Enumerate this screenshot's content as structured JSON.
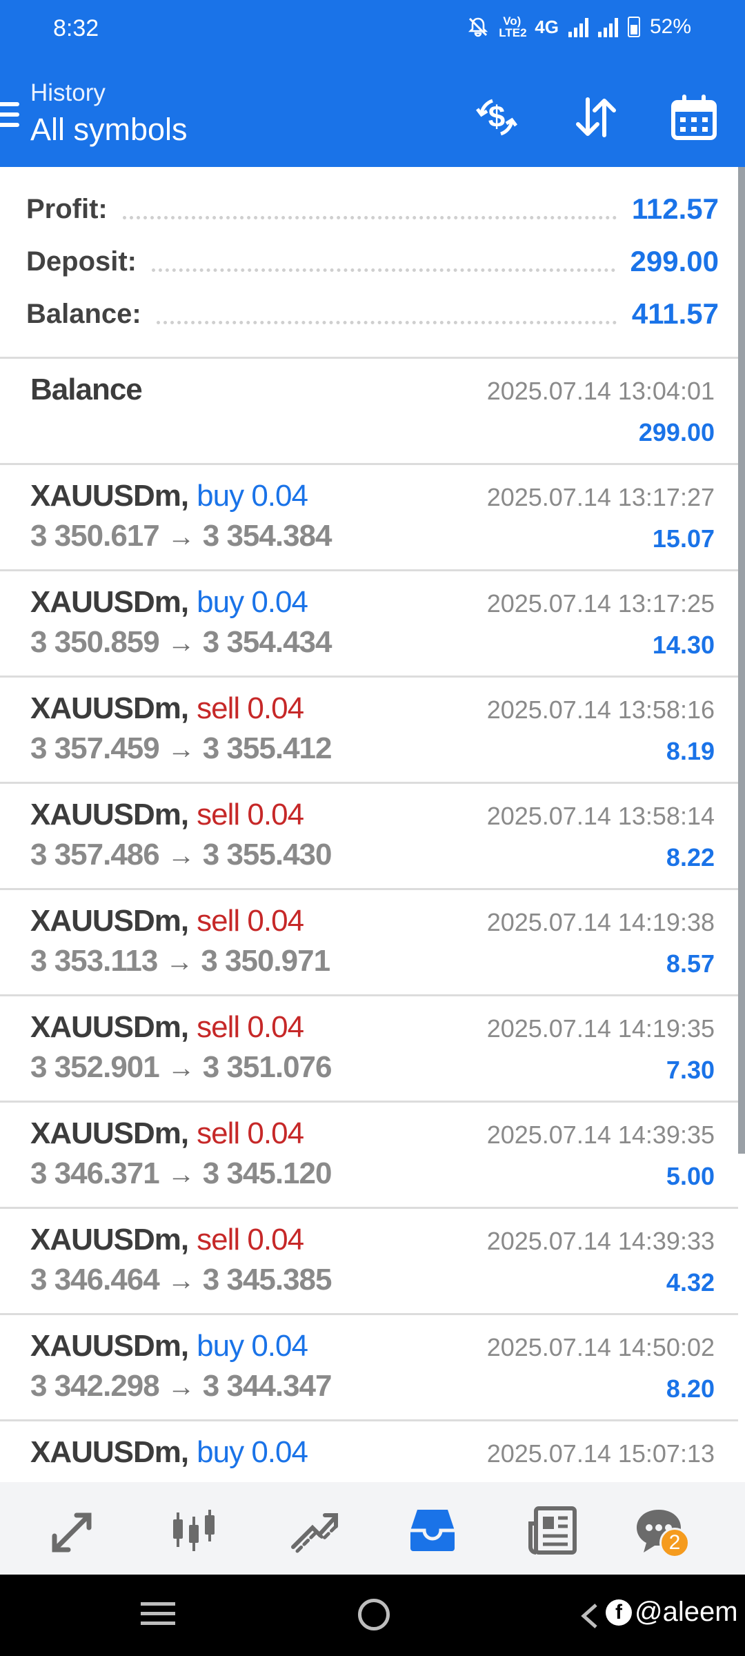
{
  "status_bar": {
    "time": "8:32",
    "volte": "Vo) LTE2",
    "network": "4G",
    "battery": "52%"
  },
  "header": {
    "subtitle": "History",
    "title": "All symbols"
  },
  "summary": {
    "profit_label": "Profit:",
    "profit_value": "112.57",
    "deposit_label": "Deposit:",
    "deposit_value": "299.00",
    "balance_label": "Balance:",
    "balance_value": "411.57"
  },
  "balance_entry": {
    "label": "Balance",
    "time": "2025.07.14 13:04:01",
    "amount": "299.00"
  },
  "trades": [
    {
      "symbol": "XAUUSDm,",
      "side": "buy",
      "volume": "buy 0.04",
      "open": "3 350.617",
      "close": "3 354.384",
      "time": "2025.07.14 13:17:27",
      "profit": "15.07"
    },
    {
      "symbol": "XAUUSDm,",
      "side": "buy",
      "volume": "buy 0.04",
      "open": "3 350.859",
      "close": "3 354.434",
      "time": "2025.07.14 13:17:25",
      "profit": "14.30"
    },
    {
      "symbol": "XAUUSDm,",
      "side": "sell",
      "volume": "sell 0.04",
      "open": "3 357.459",
      "close": "3 355.412",
      "time": "2025.07.14 13:58:16",
      "profit": "8.19"
    },
    {
      "symbol": "XAUUSDm,",
      "side": "sell",
      "volume": "sell 0.04",
      "open": "3 357.486",
      "close": "3 355.430",
      "time": "2025.07.14 13:58:14",
      "profit": "8.22"
    },
    {
      "symbol": "XAUUSDm,",
      "side": "sell",
      "volume": "sell 0.04",
      "open": "3 353.113",
      "close": "3 350.971",
      "time": "2025.07.14 14:19:38",
      "profit": "8.57"
    },
    {
      "symbol": "XAUUSDm,",
      "side": "sell",
      "volume": "sell 0.04",
      "open": "3 352.901",
      "close": "3 351.076",
      "time": "2025.07.14 14:19:35",
      "profit": "7.30"
    },
    {
      "symbol": "XAUUSDm,",
      "side": "sell",
      "volume": "sell 0.04",
      "open": "3 346.371",
      "close": "3 345.120",
      "time": "2025.07.14 14:39:35",
      "profit": "5.00"
    },
    {
      "symbol": "XAUUSDm,",
      "side": "sell",
      "volume": "sell 0.04",
      "open": "3 346.464",
      "close": "3 345.385",
      "time": "2025.07.14 14:39:33",
      "profit": "4.32"
    },
    {
      "symbol": "XAUUSDm,",
      "side": "buy",
      "volume": "buy 0.04",
      "open": "3 342.298",
      "close": "3 344.347",
      "time": "2025.07.14 14:50:02",
      "profit": "8.20"
    },
    {
      "symbol": "XAUUSDm,",
      "side": "buy",
      "volume": "buy 0.04",
      "open": "",
      "close": "",
      "time": "2025.07.14 15:07:13",
      "profit": ""
    }
  ],
  "arrow_glyph": "→",
  "bottom_nav": {
    "chat_badge": "2",
    "active_color": "#1a73e8",
    "icon_color": "#6b6b6b"
  },
  "watermark": {
    "fb_letter": "f",
    "handle": "@aleem"
  },
  "colors": {
    "primary": "#1a73e8",
    "sell": "#c62828",
    "text": "#3c3c3c",
    "muted": "#8a8a8a"
  }
}
